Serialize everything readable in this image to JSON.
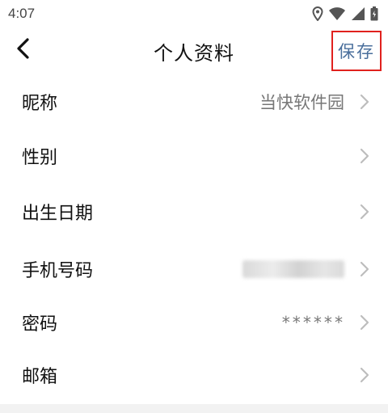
{
  "status_bar": {
    "time": "4:07",
    "icons": [
      "location-icon",
      "wifi-icon",
      "signal-icon",
      "battery-icon"
    ]
  },
  "nav": {
    "title": "个人资料",
    "save_label": "保存",
    "back_icon": "chevron-left-icon"
  },
  "rows": [
    {
      "label": "昵称",
      "value": "当快软件园"
    },
    {
      "label": "性别",
      "value": ""
    },
    {
      "label": "出生日期",
      "value": ""
    },
    {
      "label": "手机号码",
      "value": ""
    },
    {
      "label": "密码",
      "value": "******"
    },
    {
      "label": "邮箱",
      "value": ""
    }
  ],
  "colors": {
    "save_text": "#4a6f9c",
    "highlight_border": "#e0211e",
    "chevron": "#bdbdbd",
    "value_text": "#777777"
  }
}
